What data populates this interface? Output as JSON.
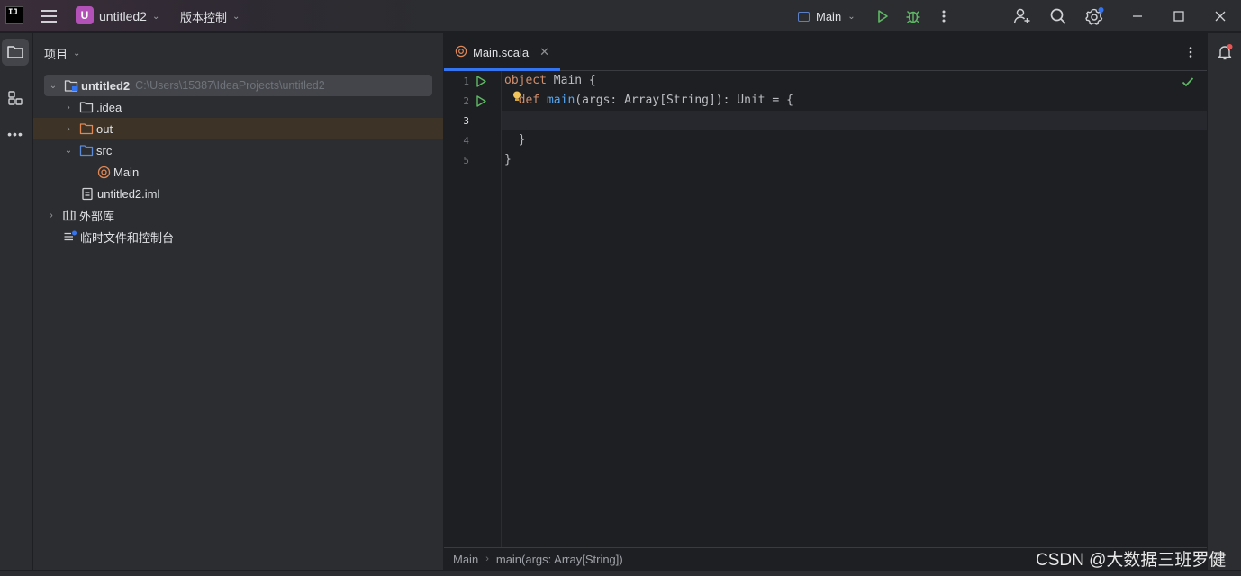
{
  "titlebar": {
    "logo_text": "IJ",
    "project_badge": "U",
    "project_name": "untitled2",
    "vcs_label": "版本控制",
    "run_config": "Main"
  },
  "project_panel": {
    "header": "项目",
    "root": {
      "name": "untitled2",
      "path": "C:\\Users\\15387\\IdeaProjects\\untitled2"
    },
    "items": [
      {
        "label": ".idea"
      },
      {
        "label": "out"
      },
      {
        "label": "src"
      },
      {
        "label": "Main"
      },
      {
        "label": "untitled2.iml"
      },
      {
        "label": "外部库"
      },
      {
        "label": "临时文件和控制台"
      }
    ]
  },
  "editor": {
    "tab_label": "Main.scala",
    "line_numbers": [
      "1",
      "2",
      "3",
      "4",
      "5"
    ],
    "code": {
      "line1_kw": "object",
      "line1_rest": " Main {",
      "line2_indent": "  ",
      "line2_kw": "def",
      "line2_space": " ",
      "line2_fn": "main",
      "line2_rest": "(args: Array[String]): Unit = {",
      "line4": "  }",
      "line5": "}"
    },
    "breadcrumb": [
      "Main",
      "main(args: Array[String])"
    ]
  },
  "watermark": "CSDN @大数据三班罗健",
  "colors": {
    "accent": "#3574f0",
    "keyword": "#cf8e6d",
    "function": "#56a8f5",
    "run_green": "#5fb865"
  }
}
